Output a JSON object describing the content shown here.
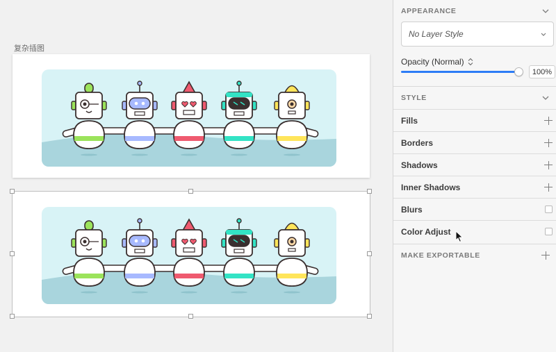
{
  "canvas": {
    "artboard_title": "复杂插图"
  },
  "inspector": {
    "appearance": {
      "title": "APPEARANCE",
      "layer_style": "No Layer Style",
      "opacity_label": "Opacity (Normal)",
      "opacity_value": "100%",
      "opacity_level": 1.0
    },
    "style": {
      "title": "STYLE",
      "rows": [
        {
          "label": "Fills",
          "control": "plus"
        },
        {
          "label": "Borders",
          "control": "plus"
        },
        {
          "label": "Shadows",
          "control": "plus"
        },
        {
          "label": "Inner Shadows",
          "control": "plus"
        },
        {
          "label": "Blurs",
          "control": "checkbox"
        },
        {
          "label": "Color Adjust",
          "control": "checkbox"
        }
      ]
    },
    "export": {
      "title": "MAKE EXPORTABLE"
    }
  },
  "colors": {
    "accent": "#2c7cf6",
    "scene_bg": "#d8f3f6",
    "ground": "#a9d5dd",
    "robot_greens": "#9be35b",
    "robot_blue": "#a7b9ff",
    "robot_red": "#ef5a6f",
    "robot_teal": "#33e3c5",
    "robot_yellow": "#ffe55a"
  }
}
